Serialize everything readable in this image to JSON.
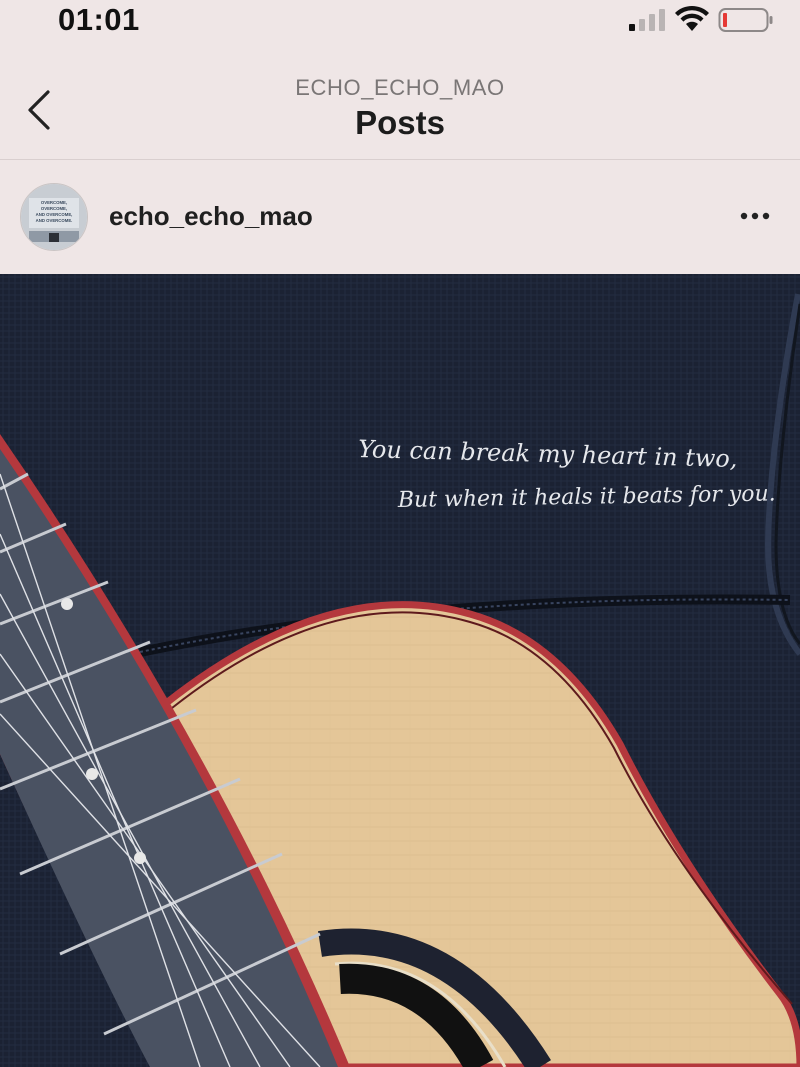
{
  "status_bar": {
    "time": "01:01",
    "signal_icon": "cellular-signal-icon",
    "wifi_icon": "wifi-icon",
    "battery_icon": "battery-low-icon",
    "battery_color": "#e53935"
  },
  "nav": {
    "subtitle": "ECHO_ECHO_MAO",
    "title": "Posts",
    "back_icon": "chevron-left-icon"
  },
  "post": {
    "username": "echo_echo_mao",
    "more_icon": "more-horizontal-icon",
    "avatar_text": [
      "OVERCOME,",
      "OVERCOME,",
      "AND OVERCOME,",
      "AND OVERCOME."
    ],
    "caption_line1": "You can break my heart in two,",
    "caption_line2": "But when it heals it beats for you."
  },
  "colors": {
    "background": "#efe6e6",
    "bag": "#1b2233",
    "guitar_top": "#e4c698",
    "binding": "#b4383d",
    "fretboard": "#4a5262"
  }
}
